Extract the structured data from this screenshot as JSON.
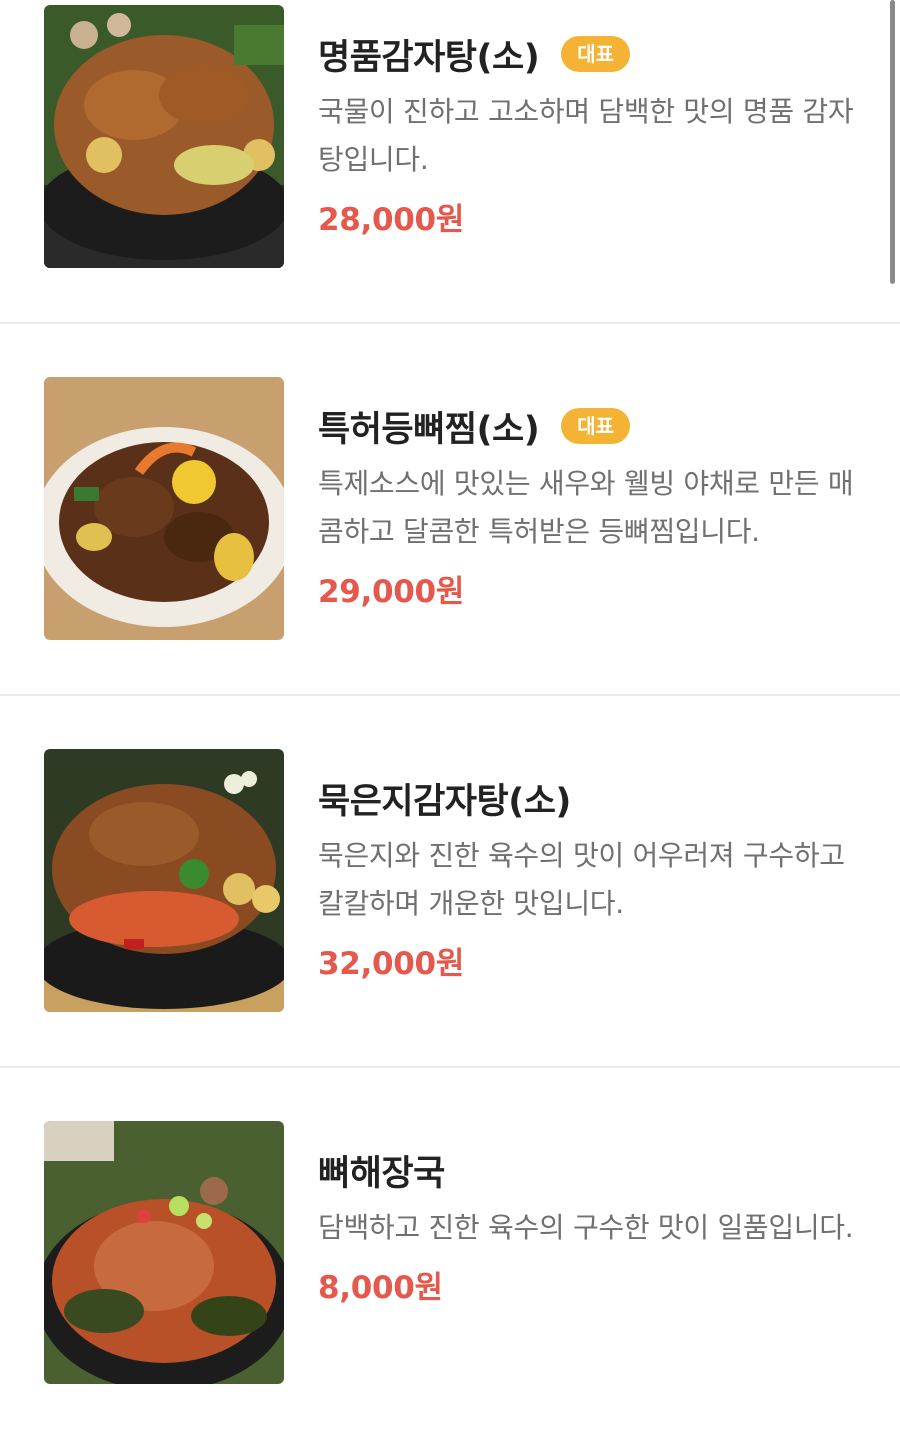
{
  "menu": {
    "items": [
      {
        "name": "명품감자탕(소)",
        "badge": "대표",
        "description": "국물이 진하고 고소하며 담백한 맛의 명품 감자탕입니다.",
        "price": "28,000원"
      },
      {
        "name": "특허등뼈찜(소)",
        "badge": "대표",
        "description": "특제소스에 맛있는 새우와 웰빙 야채로 만든 매콤하고 달콤한 특허받은 등뼈찜입니다.",
        "price": "29,000원"
      },
      {
        "name": "묵은지감자탕(소)",
        "badge": "",
        "description": "묵은지와 진한 육수의 맛이 어우러져 구수하고 칼칼하며 개운한 맛입니다.",
        "price": "32,000원"
      },
      {
        "name": "뼈해장국",
        "badge": "",
        "description": "담백하고 진한 육수의 구수한 맛이 일품입니다.",
        "price": "8,000원"
      }
    ]
  },
  "colors": {
    "price": "#e5584b",
    "badge": "#f5b335",
    "title": "#222222",
    "description": "#707070"
  }
}
